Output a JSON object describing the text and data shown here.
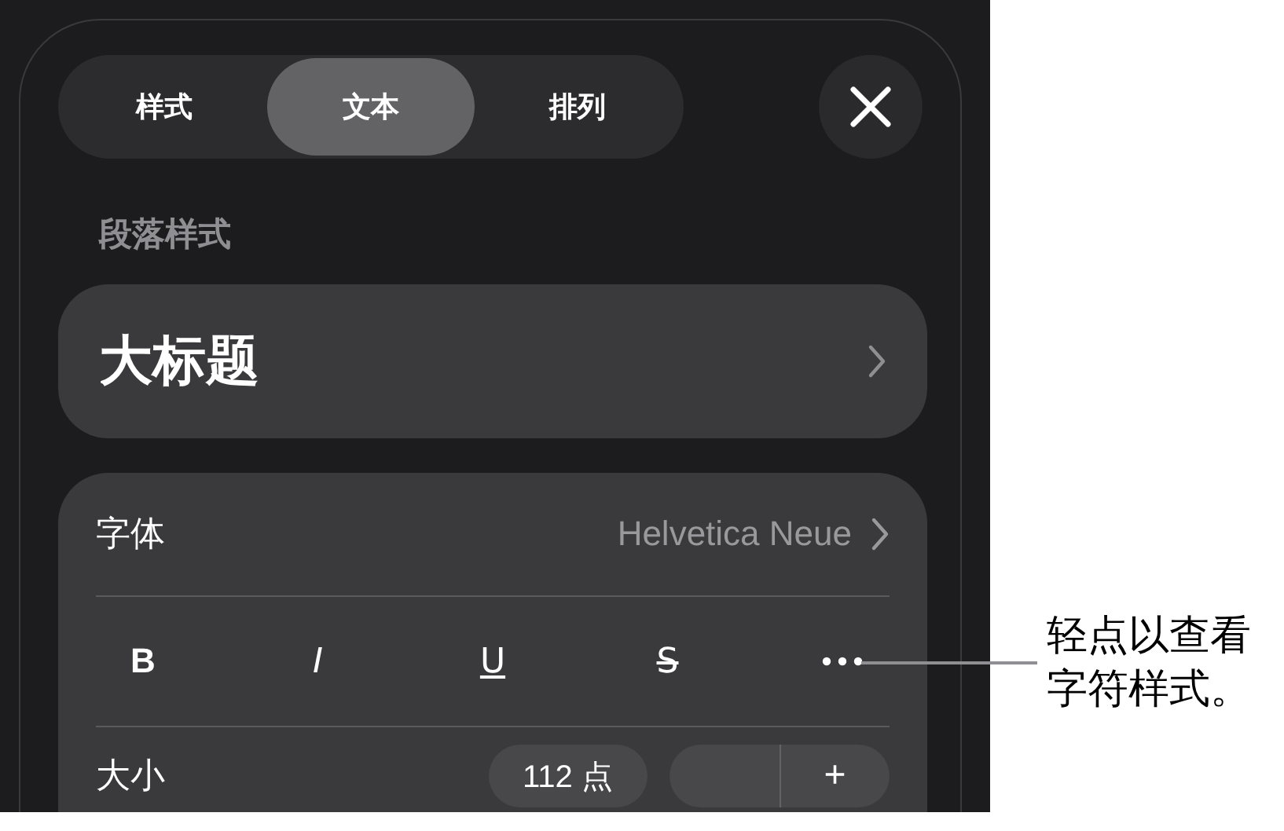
{
  "tabs": [
    {
      "label": "样式",
      "selected": false
    },
    {
      "label": "文本",
      "selected": true
    },
    {
      "label": "排列",
      "selected": false
    }
  ],
  "section_label": "段落样式",
  "paragraph_style": "大标题",
  "font": {
    "label": "字体",
    "value": "Helvetica Neue"
  },
  "style_buttons": [
    {
      "kind": "bold",
      "label": "B"
    },
    {
      "kind": "italic",
      "label": "I"
    },
    {
      "kind": "underline",
      "label": "U"
    },
    {
      "kind": "strike",
      "label": "S"
    },
    {
      "kind": "more"
    }
  ],
  "size": {
    "label": "大小",
    "value": "112 点",
    "increment": "+"
  },
  "callout": "轻点以查看字符样式。"
}
